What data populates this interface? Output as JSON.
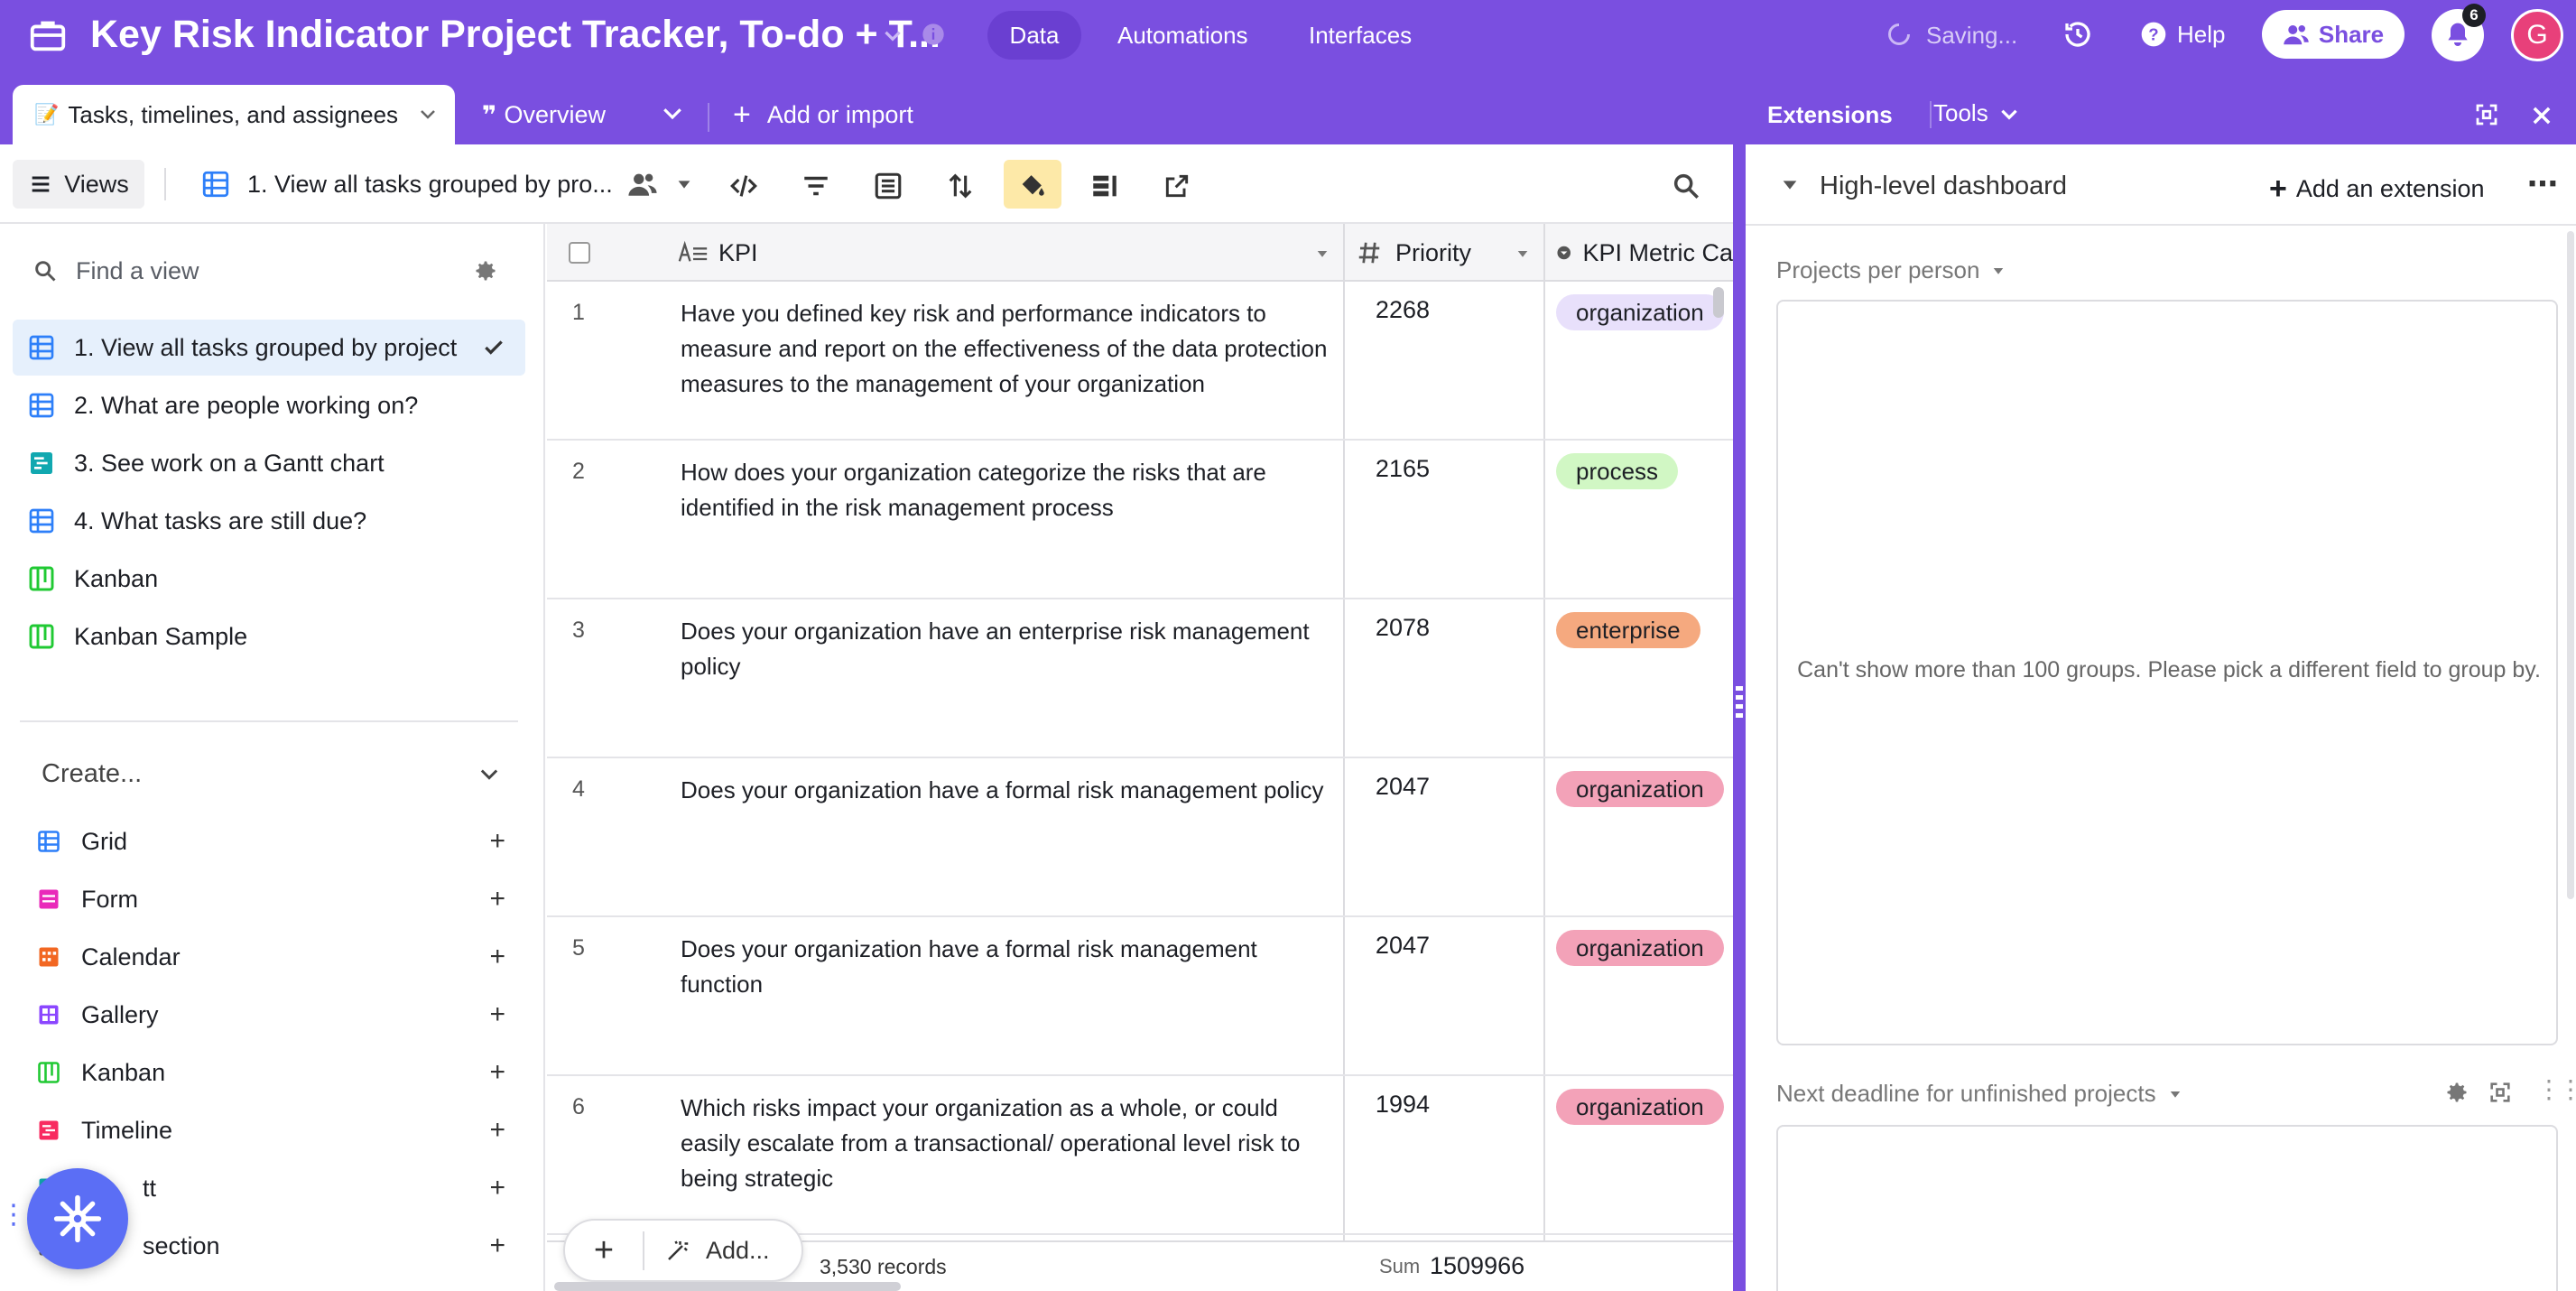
{
  "app": {
    "title": "Key Risk Indicator Project Tracker, To-do + T...",
    "nav": {
      "data": "Data",
      "automations": "Automations",
      "interfaces": "Interfaces"
    },
    "saving": "Saving...",
    "help": "Help",
    "share": "Share",
    "notification_count": "6",
    "avatar_initial": "G"
  },
  "tabs": {
    "active": "Tasks, timelines, and assignees",
    "overview": "Overview",
    "add_or_import": "Add or import"
  },
  "toolbar": {
    "views": "Views",
    "current_view": "1. View all tasks grouped by pro..."
  },
  "sidebar": {
    "find_placeholder": "Find a view",
    "views": [
      {
        "label": "1. View all tasks grouped by project",
        "icon": "grid-icon"
      },
      {
        "label": "2. What are people working on?",
        "icon": "grid-icon"
      },
      {
        "label": "3. See work on a Gantt chart",
        "icon": "gantt-icon"
      },
      {
        "label": "4. What tasks are still due?",
        "icon": "grid-icon"
      },
      {
        "label": "Kanban",
        "icon": "kanban-icon"
      },
      {
        "label": "Kanban Sample",
        "icon": "kanban-icon"
      }
    ],
    "create_label": "Create...",
    "create_items": [
      {
        "label": "Grid",
        "color": "#2d7ff9"
      },
      {
        "label": "Form",
        "color": "#e929ba"
      },
      {
        "label": "Calendar",
        "color": "#f26722"
      },
      {
        "label": "Gallery",
        "color": "#8b46ff"
      },
      {
        "label": "Kanban",
        "color": "#20c933"
      },
      {
        "label": "Timeline",
        "color": "#f82b60"
      },
      {
        "label": "tt",
        "color": "#11a8b0"
      },
      {
        "label": "section",
        "color": "#666666"
      }
    ]
  },
  "grid": {
    "columns": {
      "kpi": "KPI",
      "priority": "Priority",
      "category": "KPI Metric Ca"
    },
    "rows": [
      {
        "num": "1",
        "kpi": "Have you defined key risk and performance indicators to measure and report on the effectiveness of the data protection measures to the management of your organization",
        "priority": "2268",
        "category": "organization",
        "cat_bg": "#e8e0fb"
      },
      {
        "num": "2",
        "kpi": "How does your organization categorize the risks that are identified in the risk management process",
        "priority": "2165",
        "category": "process",
        "cat_bg": "#d1f7c4"
      },
      {
        "num": "3",
        "kpi": "Does your organization have an enterprise risk management policy",
        "priority": "2078",
        "category": "enterprise",
        "cat_bg": "#f5a97f"
      },
      {
        "num": "4",
        "kpi": "Does your organization have a formal risk management policy",
        "priority": "2047",
        "category": "organization",
        "cat_bg": "#f3a2b8"
      },
      {
        "num": "5",
        "kpi": "Does your organization have a formal risk management function",
        "priority": "2047",
        "category": "organization",
        "cat_bg": "#f3a2b8"
      },
      {
        "num": "6",
        "kpi": "Which risks impact your organization as a whole, or could easily escalate from a transactional/ operational level risk to being strategic",
        "priority": "1994",
        "category": "organization",
        "cat_bg": "#f3a2b8"
      }
    ],
    "footer": {
      "add": "Add...",
      "records": "3,530 records",
      "sum_label": "Sum",
      "sum_value": "1509966"
    }
  },
  "panel": {
    "extensions": "Extensions",
    "tools": "Tools",
    "dashboard_title": "High-level dashboard",
    "add_extension": "Add an extension",
    "widget1_title": "Projects per person",
    "widget1_message": "Can't show more than 100 groups. Please pick a different field to group by.",
    "widget2_title": "Next deadline for unfinished projects"
  },
  "colors": {
    "brand": "#7a4fe0",
    "brand_dark": "#6a3fd1",
    "selected_view": "#e6f0fc",
    "fab": "#5b6ef5"
  }
}
